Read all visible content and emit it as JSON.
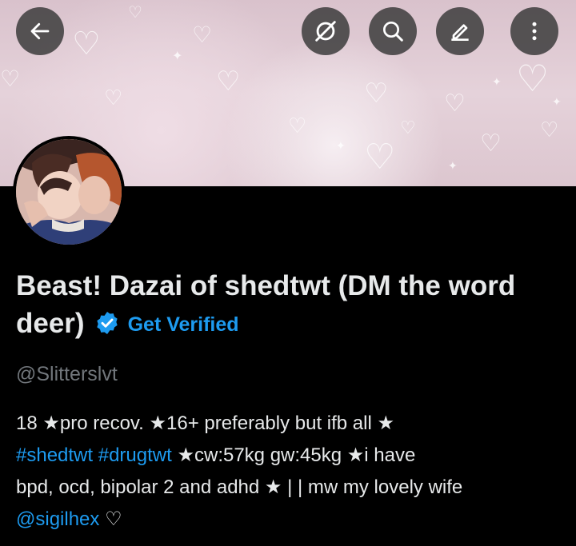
{
  "header": {
    "back_icon": "arrow-left-icon",
    "actions": [
      "mute-icon",
      "search-icon",
      "edit-icon",
      "more-vertical-icon"
    ]
  },
  "profile": {
    "display_name": "Beast! Dazai of shedtwt (DM the word deer)",
    "verified_icon": "verified-badge-icon",
    "get_verified_label": "Get Verified",
    "handle": "@Slitterslvt"
  },
  "bio": {
    "line1": "18 ★pro recov. ★16+ preferably but ifb all ★",
    "hashtag1": "#shedtwt",
    "hashtag2": "#drugtwt",
    "line2_rest": "★cw:57kg gw:45kg ★i have",
    "line3": "bpd, ocd, bipolar 2 and adhd ★ | | mw my lovely wife",
    "mention": "@sigilhex",
    "heart": "♡"
  },
  "colors": {
    "background": "#000000",
    "text": "#e7e9ea",
    "secondary_text": "#71767b",
    "accent": "#1d9bf0",
    "banner": "#e2cdd6"
  }
}
